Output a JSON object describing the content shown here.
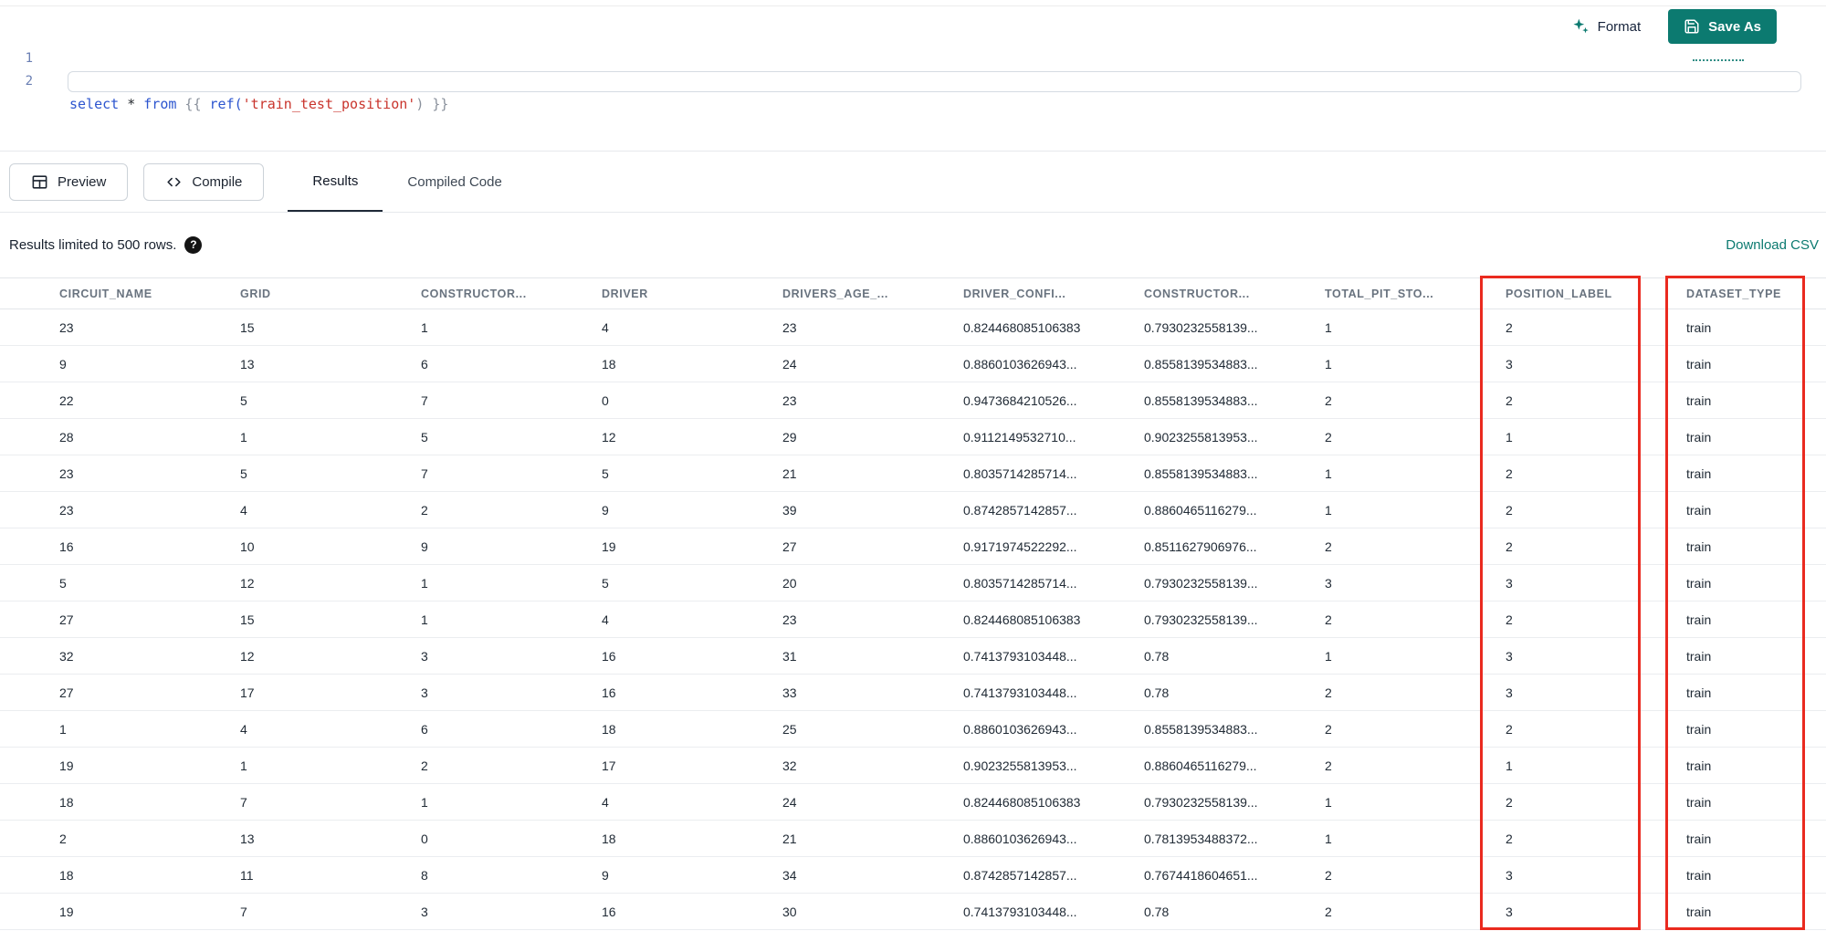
{
  "colors": {
    "accent_teal": "#0c7a70",
    "annotation_red": "#ea2a1f",
    "active_tab_underline": "#1f2937"
  },
  "header": {
    "format_label": "Format",
    "save_as_label": "Save As"
  },
  "editor": {
    "line_numbers": [
      "1",
      "2"
    ],
    "code": {
      "kw_select": "select",
      "op_star": " * ",
      "kw_from": "from",
      "jinja_open": " {{ ",
      "fn_ref": "ref(",
      "string": "'train_test_position'",
      "paren_close": ")",
      "jinja_close": " }}"
    }
  },
  "toolbar": {
    "preview_label": "Preview",
    "compile_label": "Compile",
    "tabs": [
      {
        "label": "Results",
        "active": true
      },
      {
        "label": "Compiled Code",
        "active": false
      }
    ]
  },
  "results_bar": {
    "limit_text": "Results limited to 500 rows.",
    "help_glyph": "?",
    "download_label": "Download CSV"
  },
  "table": {
    "columns": [
      "CIRCUIT_NAME",
      "GRID",
      "CONSTRUCTOR...",
      "DRIVER",
      "DRIVERS_AGE_...",
      "DRIVER_CONFI...",
      "CONSTRUCTOR...",
      "TOTAL_PIT_STO...",
      "POSITION_LABEL",
      "DATASET_TYPE"
    ],
    "rows": [
      [
        "23",
        "15",
        "1",
        "4",
        "23",
        "0.824468085106383",
        "0.7930232558139...",
        "1",
        "2",
        "train"
      ],
      [
        "9",
        "13",
        "6",
        "18",
        "24",
        "0.8860103626943...",
        "0.8558139534883...",
        "1",
        "3",
        "train"
      ],
      [
        "22",
        "5",
        "7",
        "0",
        "23",
        "0.9473684210526...",
        "0.8558139534883...",
        "2",
        "2",
        "train"
      ],
      [
        "28",
        "1",
        "5",
        "12",
        "29",
        "0.9112149532710...",
        "0.9023255813953...",
        "2",
        "1",
        "train"
      ],
      [
        "23",
        "5",
        "7",
        "5",
        "21",
        "0.8035714285714...",
        "0.8558139534883...",
        "1",
        "2",
        "train"
      ],
      [
        "23",
        "4",
        "2",
        "9",
        "39",
        "0.8742857142857...",
        "0.8860465116279...",
        "1",
        "2",
        "train"
      ],
      [
        "16",
        "10",
        "9",
        "19",
        "27",
        "0.9171974522292...",
        "0.8511627906976...",
        "2",
        "2",
        "train"
      ],
      [
        "5",
        "12",
        "1",
        "5",
        "20",
        "0.8035714285714...",
        "0.7930232558139...",
        "3",
        "3",
        "train"
      ],
      [
        "27",
        "15",
        "1",
        "4",
        "23",
        "0.824468085106383",
        "0.7930232558139...",
        "2",
        "2",
        "train"
      ],
      [
        "32",
        "12",
        "3",
        "16",
        "31",
        "0.7413793103448...",
        "0.78",
        "1",
        "3",
        "train"
      ],
      [
        "27",
        "17",
        "3",
        "16",
        "33",
        "0.7413793103448...",
        "0.78",
        "2",
        "3",
        "train"
      ],
      [
        "1",
        "4",
        "6",
        "18",
        "25",
        "0.8860103626943...",
        "0.8558139534883...",
        "2",
        "2",
        "train"
      ],
      [
        "19",
        "1",
        "2",
        "17",
        "32",
        "0.9023255813953...",
        "0.8860465116279...",
        "2",
        "1",
        "train"
      ],
      [
        "18",
        "7",
        "1",
        "4",
        "24",
        "0.824468085106383",
        "0.7930232558139...",
        "1",
        "2",
        "train"
      ],
      [
        "2",
        "13",
        "0",
        "18",
        "21",
        "0.8860103626943...",
        "0.7813953488372...",
        "1",
        "2",
        "train"
      ],
      [
        "18",
        "11",
        "8",
        "9",
        "34",
        "0.8742857142857...",
        "0.7674418604651...",
        "2",
        "3",
        "train"
      ],
      [
        "19",
        "7",
        "3",
        "16",
        "30",
        "0.7413793103448...",
        "0.78",
        "2",
        "3",
        "train"
      ]
    ]
  },
  "annotations": {
    "highlighted_columns": [
      "POSITION_LABEL",
      "DATASET_TYPE"
    ],
    "color": "#ea2a1f"
  }
}
